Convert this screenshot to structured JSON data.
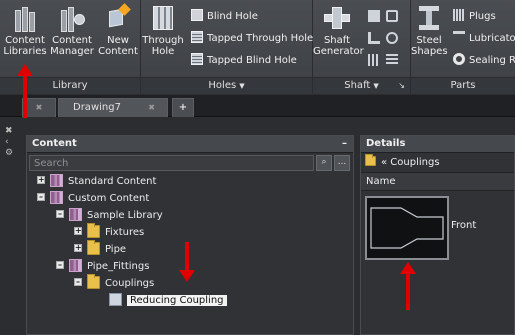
{
  "ribbon": {
    "library": {
      "title": "Library",
      "content_libraries": [
        "Content",
        "Libraries"
      ],
      "content_manager": [
        "Content",
        "Manager"
      ],
      "new_content": [
        "New",
        "Content"
      ]
    },
    "holes": {
      "title": "Holes",
      "through_hole": [
        "Through",
        "Hole"
      ],
      "blind_hole": "Blind Hole",
      "tapped_through_hole": "Tapped Through Hole",
      "tapped_blind_hole": "Tapped Blind Hole"
    },
    "shaft": {
      "title": "Shaft",
      "shaft_generator": [
        "Shaft",
        "Generator"
      ]
    },
    "parts": {
      "title": "Parts",
      "steel_shapes": [
        "Steel",
        "Shapes"
      ],
      "plugs": "Plugs",
      "lubricator": "Lubricator",
      "sealing_rings": "Sealing Ri"
    }
  },
  "tabs": {
    "drawing": "Drawing7",
    "close": "✖",
    "add": "+"
  },
  "gutter": [
    "✖",
    "‹",
    "⚙"
  ],
  "content_panel": {
    "title": "Content",
    "minimize": "–",
    "search_placeholder": "Search",
    "search_button": "⌕",
    "more_button": "...",
    "tree": [
      {
        "label": "Standard Content",
        "expander": "+",
        "icon": "library"
      },
      {
        "label": "Custom Content",
        "expander": "–",
        "icon": "library"
      },
      {
        "label": "Sample Library",
        "expander": "–",
        "icon": "library"
      },
      {
        "label": "Fixtures",
        "expander": "+",
        "icon": "folder"
      },
      {
        "label": "Pipe",
        "expander": "+",
        "icon": "folder"
      },
      {
        "label": "Pipe_Fittings",
        "expander": "–",
        "icon": "library"
      },
      {
        "label": "Couplings",
        "expander": "–",
        "icon": "folder"
      },
      {
        "label": "Reducing Coupling",
        "expander": "",
        "icon": "part"
      }
    ]
  },
  "details_panel": {
    "title": "Details",
    "breadcrumb": "« Couplings",
    "column_header": "Name",
    "view_label": "Front"
  },
  "colors": {
    "accent_arrow": "#e00000",
    "panel_bg": "#303236",
    "ribbon_bg": "#4a4d52",
    "folder": "#e8c04a"
  }
}
